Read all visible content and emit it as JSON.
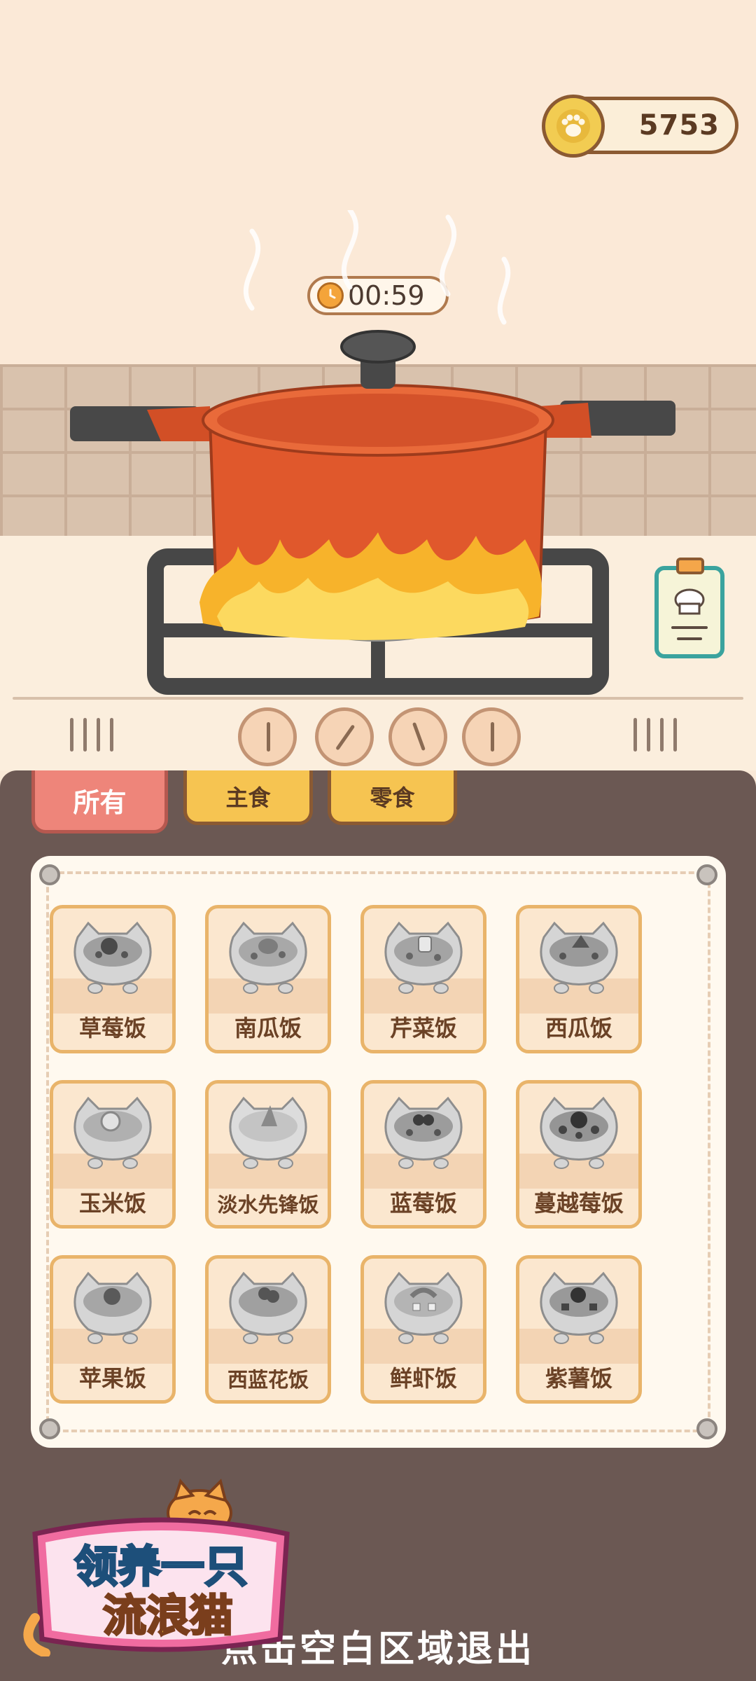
{
  "hud": {
    "coins": "5753",
    "coin_icon": "paw-coin-icon"
  },
  "cooking": {
    "timer": "00:59",
    "timer_icon": "clock-icon"
  },
  "tabs": [
    {
      "label": "所有",
      "active": true
    },
    {
      "label": "主食",
      "active": false
    },
    {
      "label": "零食",
      "active": false
    }
  ],
  "dishes": [
    {
      "name": "草莓饭"
    },
    {
      "name": "南瓜饭"
    },
    {
      "name": "芹菜饭"
    },
    {
      "name": "西瓜饭"
    },
    {
      "name": "玉米饭"
    },
    {
      "name": "淡水先锋饭"
    },
    {
      "name": "蓝莓饭"
    },
    {
      "name": "蔓越莓饭"
    },
    {
      "name": "苹果饭"
    },
    {
      "name": "西蓝花饭"
    },
    {
      "name": "鲜虾饭"
    },
    {
      "name": "紫薯饭"
    }
  ],
  "footer": {
    "exit_hint": "点击空白区域退出"
  },
  "logo": {
    "line1": "领养一只",
    "line2": "流浪猫"
  },
  "colors": {
    "accent": "#f6c451",
    "active_tab": "#ee857a",
    "panel": "#6b5853",
    "pot": "#e0582c",
    "flame": "#f7b32b",
    "teal": "#3aa39e"
  }
}
